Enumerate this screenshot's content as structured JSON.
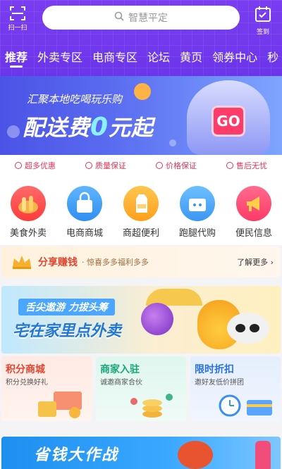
{
  "header": {
    "scan_label": "扫一扫",
    "search_placeholder": "智慧平定",
    "sign_label": "签到"
  },
  "tabs": [
    {
      "label": "推荐",
      "active": true
    },
    {
      "label": "外卖专区"
    },
    {
      "label": "电商专区"
    },
    {
      "label": "论坛"
    },
    {
      "label": "黄页"
    },
    {
      "label": "领券中心"
    },
    {
      "label": "秒"
    }
  ],
  "banner": {
    "line1": "汇聚本地吃喝玩乐购",
    "line2_prefix": "配送费",
    "line2_zero": "0",
    "line2_suffix": "元起",
    "go": "GO"
  },
  "guarantees": [
    "超多优惠",
    "质量保证",
    "价格保证",
    "售后无忧"
  ],
  "categories": [
    {
      "label": "美食外卖",
      "icon": "bread-icon",
      "color": "#ff4d4d"
    },
    {
      "label": "电商商城",
      "icon": "shopping-bag-icon",
      "color": "#3aa0ff"
    },
    {
      "label": "商超便利",
      "icon": "milk-icon",
      "color": "#ffb02e"
    },
    {
      "label": "跑腿代购",
      "icon": "delivery-box-icon",
      "color": "#3aa0ff"
    },
    {
      "label": "便民信息",
      "icon": "megaphone-icon",
      "color": "#ff3f6b"
    }
  ],
  "share": {
    "title": "分享赚钱",
    "subtitle": "· 惊喜多多福利多多",
    "more": "了解更多 ›"
  },
  "promo": {
    "ribbon": "舌尖遨游 力拔头筹",
    "main": "宅在家里点外卖"
  },
  "cards": [
    {
      "title": "积分商城",
      "subtitle": "积分兑换好礼"
    },
    {
      "title": "商家入驻",
      "subtitle": "诚邀商家合伙"
    },
    {
      "title": "限时折扣",
      "subtitle": "邀好友低价拼团"
    }
  ],
  "bottom_banner": {
    "text": "省钱大作战"
  }
}
